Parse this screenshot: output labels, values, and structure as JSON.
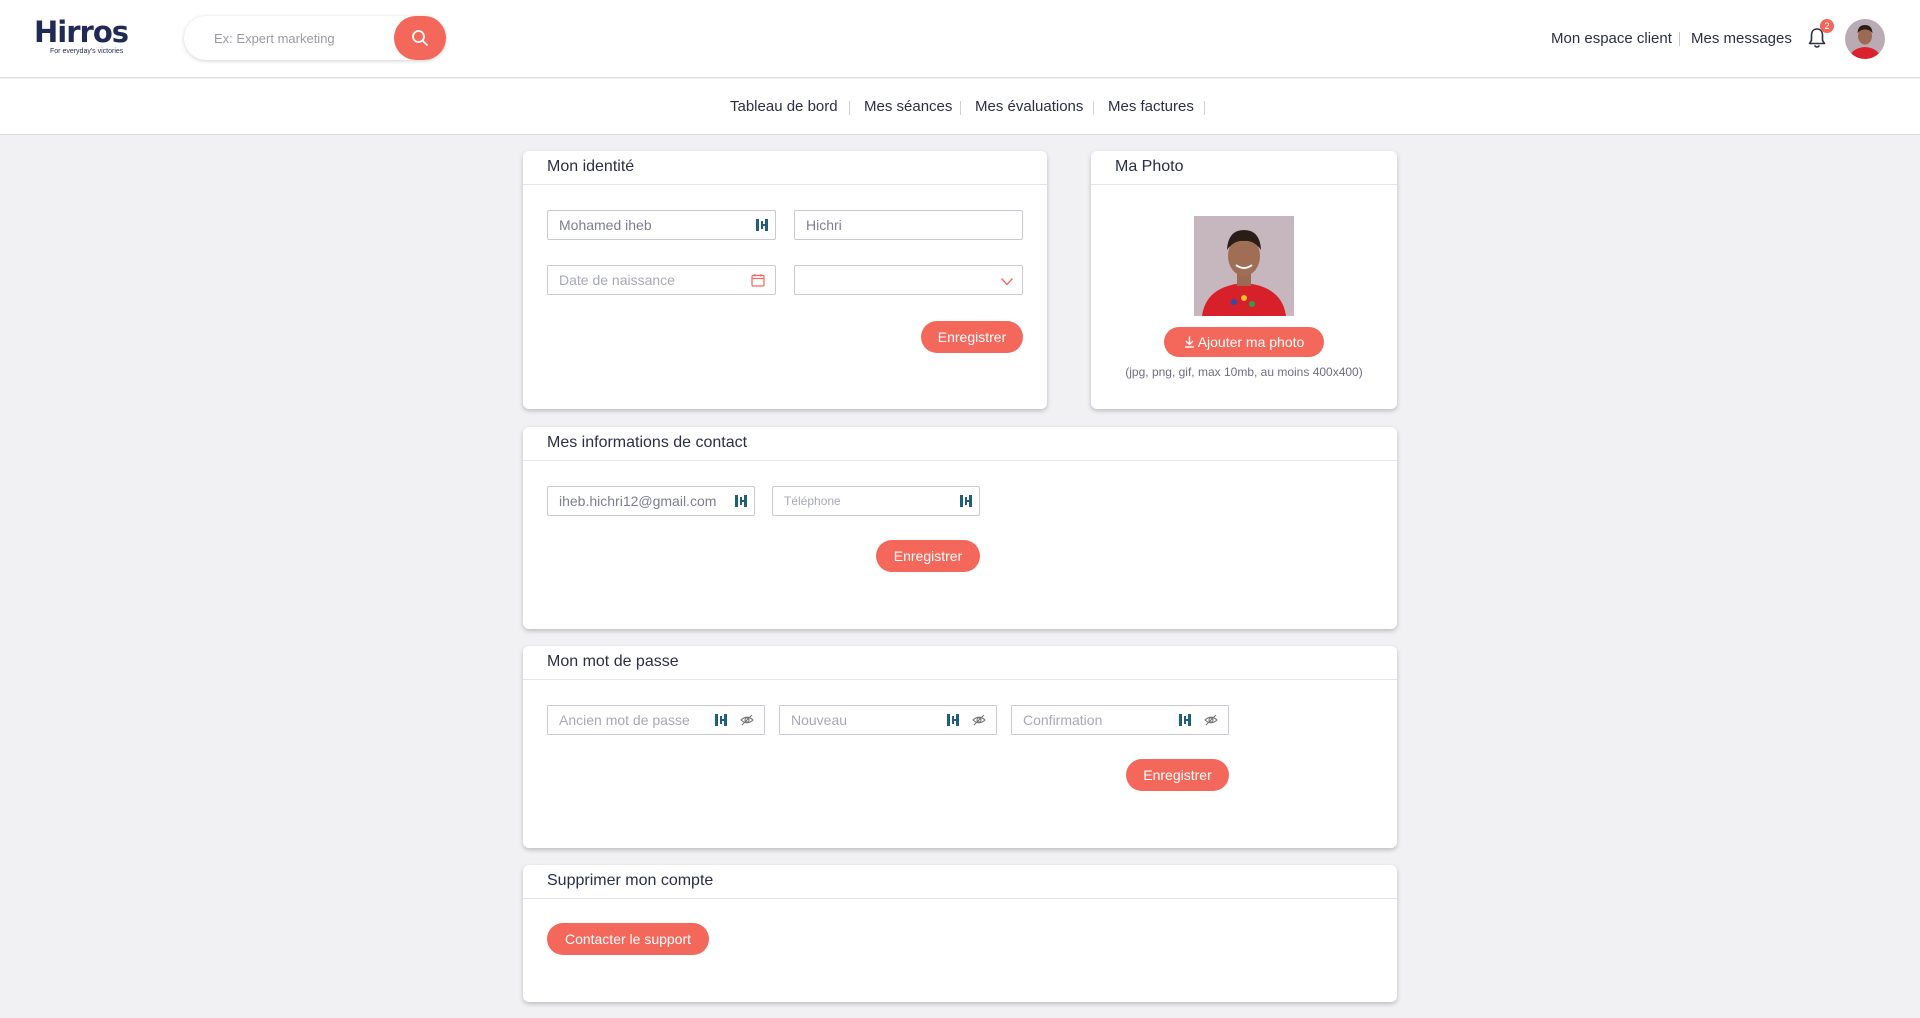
{
  "header": {
    "logo_text": "Hirros",
    "logo_tagline": "For everyday's victories",
    "search_placeholder": "Ex: Expert marketing",
    "links": [
      "Mon espace client",
      "Mes messages"
    ],
    "notification_count": "2"
  },
  "subnav": {
    "items": [
      "Tableau de bord",
      "Mes séances",
      "Mes évaluations",
      "Mes factures"
    ]
  },
  "identity": {
    "title": "Mon identité",
    "first_name": "Mohamed iheb",
    "last_name": "Hichri",
    "birthdate_placeholder": "Date de naissance",
    "gender_value": "",
    "save_label": "Enregistrer"
  },
  "photo": {
    "title": "Ma Photo",
    "add_label": "Ajouter ma photo",
    "hint": "(jpg, png, gif, max 10mb, au moins 400x400)"
  },
  "contact": {
    "title": "Mes informations de contact",
    "email": "iheb.hichri12@gmail.com",
    "phone_placeholder": "Téléphone",
    "save_label": "Enregistrer"
  },
  "password": {
    "title": "Mon mot de passe",
    "old_placeholder": "Ancien mot de passe",
    "new_placeholder": "Nouveau",
    "confirm_placeholder": "Confirmation",
    "save_label": "Enregistrer"
  },
  "delete_account": {
    "title": "Supprimer mon compte",
    "support_label": "Contacter le support"
  },
  "colors": {
    "accent": "#f4675b",
    "text": "#2b2f45",
    "background": "#f1f1f3",
    "key_icon": "#1f5f78"
  }
}
